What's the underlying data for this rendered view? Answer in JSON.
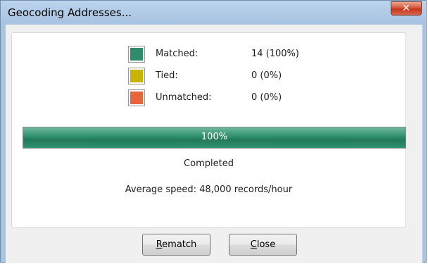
{
  "window": {
    "title": "Geocoding Addresses...",
    "close_glyph": "✕"
  },
  "stats": [
    {
      "label": "Matched:",
      "value": "14 (100%)",
      "color": "#2e8b6b",
      "icon": "matched-swatch"
    },
    {
      "label": "Tied:",
      "value": "0 (0%)",
      "color": "#c9b400",
      "icon": "tied-swatch"
    },
    {
      "label": "Unmatched:",
      "value": "0 (0%)",
      "color": "#e9643a",
      "icon": "unmatched-swatch"
    }
  ],
  "progress": {
    "percent": 100,
    "label": "100%"
  },
  "status": "Completed",
  "speed": "Average speed: 48,000 records/hour",
  "buttons": {
    "rematch": {
      "mnemonic": "R",
      "rest": "ematch"
    },
    "close": {
      "mnemonic": "C",
      "rest": "lose"
    }
  }
}
